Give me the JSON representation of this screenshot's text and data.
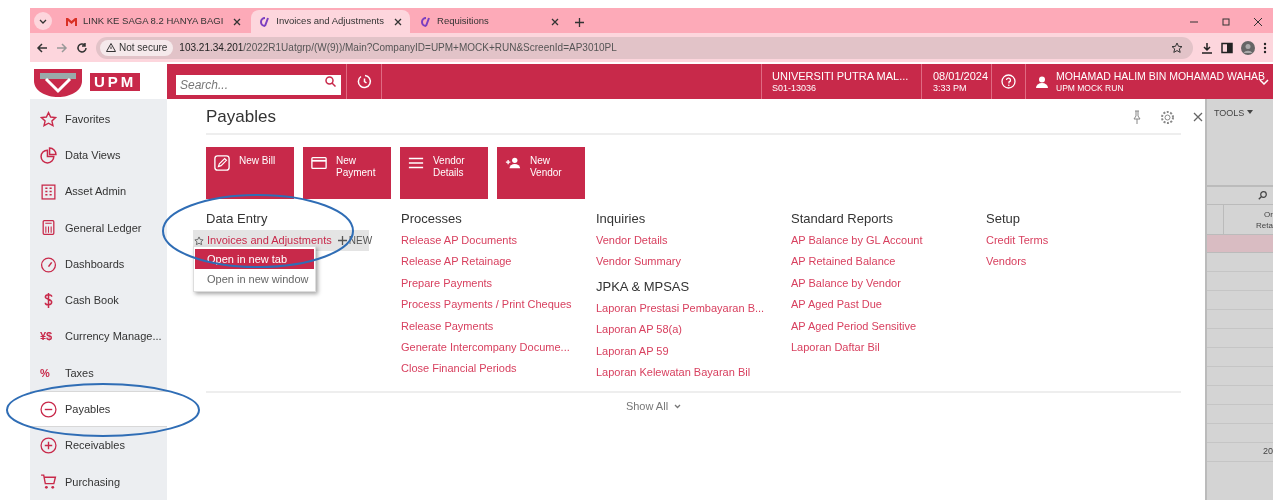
{
  "browser": {
    "tabs": [
      {
        "title": "LINK KE SAGA 8.2 HANYA BAGI",
        "selected": false
      },
      {
        "title": "Invoices and Adjustments",
        "selected": true
      },
      {
        "title": "Requisitions",
        "selected": false
      }
    ],
    "address": {
      "security": "Not secure",
      "host": "103.21.34.201",
      "path": "/2022R1Uatgrp/(W(9))/Main?CompanyID=UPM+MOCK+RUN&ScreenId=AP3010PL"
    }
  },
  "app_header": {
    "logo_text": "UPM",
    "search_placeholder": "Search...",
    "company_name": "UNIVERSITI PUTRA MAL...",
    "company_code": "S01-13036",
    "date": "08/01/2024",
    "time": "3:33 PM",
    "user_name": "MOHAMAD HALIM BIN MOHAMAD WAHAB",
    "user_company": "UPM MOCK RUN"
  },
  "sidebar": {
    "items": [
      {
        "label": "Favorites",
        "kind": "icon",
        "selected": false
      },
      {
        "label": "Data Views",
        "kind": "icon",
        "selected": false
      },
      {
        "label": "Asset Admin",
        "kind": "icon",
        "selected": false
      },
      {
        "label": "General Ledger",
        "kind": "icon",
        "selected": false
      },
      {
        "label": "Dashboards",
        "kind": "icon",
        "selected": false
      },
      {
        "label": "Cash Book",
        "kind": "icon",
        "selected": false
      },
      {
        "label": "Currency Manage...",
        "kind": "glyph",
        "glyph": "¥$",
        "selected": false
      },
      {
        "label": "Taxes",
        "kind": "glyph",
        "glyph": "%",
        "selected": false
      },
      {
        "label": "Payables",
        "kind": "icon",
        "selected": true
      },
      {
        "label": "Receivables",
        "kind": "icon",
        "selected": false
      },
      {
        "label": "Purchasing",
        "kind": "icon",
        "selected": false
      }
    ]
  },
  "workspace": {
    "title": "Payables",
    "tiles": [
      "New Bill",
      "New Payment",
      "Vendor Details",
      "New Vendor"
    ],
    "columns": [
      {
        "sections": [
          {
            "heading": "Data Entry",
            "links": [
              {
                "label": "Invoices and Adjustments",
                "highlighted": true,
                "new_label": "NEW"
              }
            ]
          }
        ]
      },
      {
        "sections": [
          {
            "heading": "Processes",
            "links": [
              {
                "label": "Release AP Documents",
                "highlighted": false
              },
              {
                "label": "Release AP Retainage",
                "highlighted": false
              },
              {
                "label": "Prepare Payments",
                "highlighted": false
              },
              {
                "label": "Process Payments / Print Cheques",
                "highlighted": false
              },
              {
                "label": "Release Payments",
                "highlighted": false
              },
              {
                "label": "Generate Intercompany Docume...",
                "highlighted": false
              },
              {
                "label": "Close Financial Periods",
                "highlighted": false
              }
            ]
          }
        ]
      },
      {
        "sections": [
          {
            "heading": "Inquiries",
            "links": [
              {
                "label": "Vendor Details",
                "highlighted": false
              },
              {
                "label": "Vendor Summary",
                "highlighted": false
              }
            ]
          },
          {
            "heading": "JPKA & MPSAS",
            "links": [
              {
                "label": "Laporan Prestasi Pembayaran B...",
                "highlighted": false
              },
              {
                "label": "Laporan AP 58(a)",
                "highlighted": false
              },
              {
                "label": "Laporan AP 59",
                "highlighted": false
              },
              {
                "label": "Laporan Kelewatan Bayaran Bil",
                "highlighted": false
              }
            ]
          }
        ]
      },
      {
        "sections": [
          {
            "heading": "Standard Reports",
            "links": [
              {
                "label": "AP Balance by GL Account",
                "highlighted": false
              },
              {
                "label": "AP Retained Balance",
                "highlighted": false
              },
              {
                "label": "AP Balance by Vendor",
                "highlighted": false
              },
              {
                "label": "AP Aged Past Due",
                "highlighted": false
              },
              {
                "label": "AP Aged Period Sensitive",
                "highlighted": false
              },
              {
                "label": "Laporan Daftar Bil",
                "highlighted": false
              }
            ]
          }
        ]
      },
      {
        "sections": [
          {
            "heading": "Setup",
            "links": [
              {
                "label": "Credit Terms",
                "highlighted": false
              },
              {
                "label": "Vendors",
                "highlighted": false
              }
            ]
          }
        ]
      }
    ],
    "show_all": "Show All"
  },
  "context_menu": {
    "items": [
      {
        "label": "Open in new tab",
        "selected": true
      },
      {
        "label": "Open in new window",
        "selected": false
      }
    ]
  },
  "background_screen": {
    "tools": "TOOLS",
    "column_header": [
      "Or",
      "Reta"
    ],
    "cell": "20"
  }
}
